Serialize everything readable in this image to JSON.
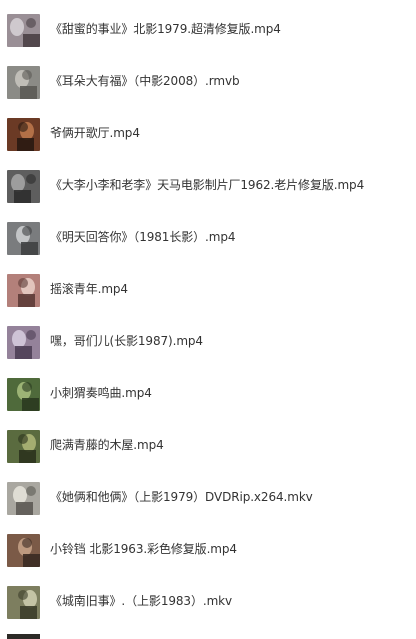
{
  "files": [
    {
      "name": "《甜蜜的事业》北影1979.超清修复版.mp4",
      "thumb_icon": "video-thumbnail-icon",
      "colors": [
        "#9a8f96",
        "#d8d4d8",
        "#4a3f44"
      ]
    },
    {
      "name": "《耳朵大有福》（中影2008）.rmvb",
      "thumb_icon": "video-thumbnail-icon",
      "colors": [
        "#8b8b86",
        "#c9c7c0",
        "#5b5a55"
      ]
    },
    {
      "name": "爷俩开歌厅.mp4",
      "thumb_icon": "video-thumbnail-icon",
      "colors": [
        "#6b3a25",
        "#c07a4e",
        "#2a1a12"
      ]
    },
    {
      "name": "《大李小李和老李》天马电影制片厂1962.老片修复版.mp4",
      "thumb_icon": "video-thumbnail-icon",
      "colors": [
        "#5e5e5e",
        "#a8a8a8",
        "#2d2d2d"
      ]
    },
    {
      "name": "《明天回答你》（1981长影）.mp4",
      "thumb_icon": "video-thumbnail-icon",
      "colors": [
        "#7a7c7e",
        "#d0d2d3",
        "#3f4143"
      ]
    },
    {
      "name": "摇滚青年.mp4",
      "thumb_icon": "video-thumbnail-icon",
      "colors": [
        "#b3807a",
        "#ead0c8",
        "#5c3a36"
      ]
    },
    {
      "name": "嘿，哥们儿(长影1987).mp4",
      "thumb_icon": "video-thumbnail-icon",
      "colors": [
        "#94829a",
        "#d8cfe0",
        "#4d3e55"
      ]
    },
    {
      "name": "小刺猬奏鸣曲.mp4",
      "thumb_icon": "video-thumbnail-icon",
      "colors": [
        "#4f6a3b",
        "#a9c080",
        "#2a3a20"
      ]
    },
    {
      "name": "爬满青藤的木屋.mp4",
      "thumb_icon": "video-thumbnail-icon",
      "colors": [
        "#5a6b3f",
        "#b0b879",
        "#2b331d"
      ]
    },
    {
      "name": "《她俩和他俩》（上影1979）DVDRip.x264.mkv",
      "thumb_icon": "video-thumbnail-icon",
      "colors": [
        "#a9a7a0",
        "#e9e6dd",
        "#5c5a54"
      ]
    },
    {
      "name": "小铃铛 北影1963.彩色修复版.mp4",
      "thumb_icon": "video-thumbnail-icon",
      "colors": [
        "#7b5a47",
        "#c9a58a",
        "#3a2a22"
      ]
    },
    {
      "name": "《城南旧事》.（上影1983）.mkv",
      "thumb_icon": "video-thumbnail-icon",
      "colors": [
        "#7d7e5f",
        "#d0cfb2",
        "#3c3d2a"
      ]
    }
  ]
}
